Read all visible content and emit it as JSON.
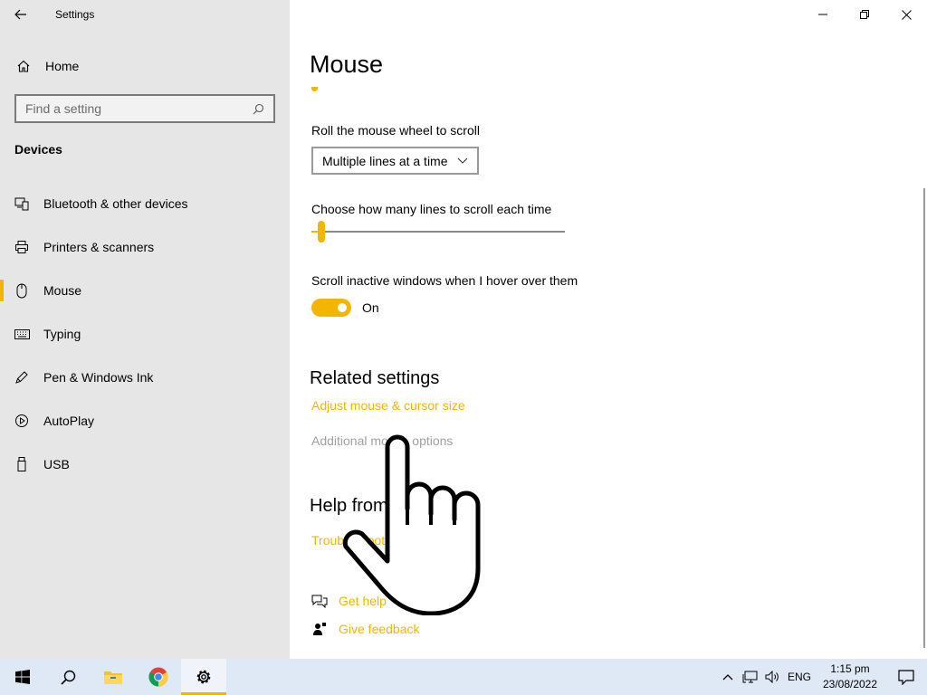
{
  "app": {
    "title": "Settings"
  },
  "sidebar": {
    "home_label": "Home",
    "search_placeholder": "Find a setting",
    "section_title": "Devices",
    "items": [
      {
        "label": "Bluetooth & other devices",
        "icon": "bluetooth-devices-icon",
        "active": false
      },
      {
        "label": "Printers & scanners",
        "icon": "printer-icon",
        "active": false
      },
      {
        "label": "Mouse",
        "icon": "mouse-icon",
        "active": true
      },
      {
        "label": "Typing",
        "icon": "keyboard-icon",
        "active": false
      },
      {
        "label": "Pen & Windows Ink",
        "icon": "pen-icon",
        "active": false
      },
      {
        "label": "AutoPlay",
        "icon": "autoplay-icon",
        "active": false
      },
      {
        "label": "USB",
        "icon": "usb-icon",
        "active": false
      }
    ]
  },
  "main": {
    "title": "Mouse",
    "scroll_label": "Roll the mouse wheel to scroll",
    "scroll_dropdown_value": "Multiple lines at a time",
    "lines_label": "Choose how many lines to scroll each time",
    "lines_slider_value": 3,
    "inactive_label": "Scroll inactive windows when I hover over them",
    "inactive_toggle_state": "On",
    "related_title": "Related settings",
    "related_links": [
      "Adjust mouse & cursor size",
      "Additional mouse options"
    ],
    "help_title": "Help from the web",
    "help_link": "Troubleshooting",
    "get_help": "Get help",
    "give_feedback": "Give feedback"
  },
  "taskbar": {
    "apps": [
      "windows-start-icon",
      "search-icon",
      "file-explorer-icon",
      "chrome-icon",
      "settings-gear-icon"
    ],
    "language": "ENG",
    "time": "1:15 pm",
    "date": "23/08/2022"
  },
  "colors": {
    "accent": "#f2b600",
    "sidebar_bg": "#e6e6e6",
    "taskbar_bg": "#dfe9f5"
  }
}
